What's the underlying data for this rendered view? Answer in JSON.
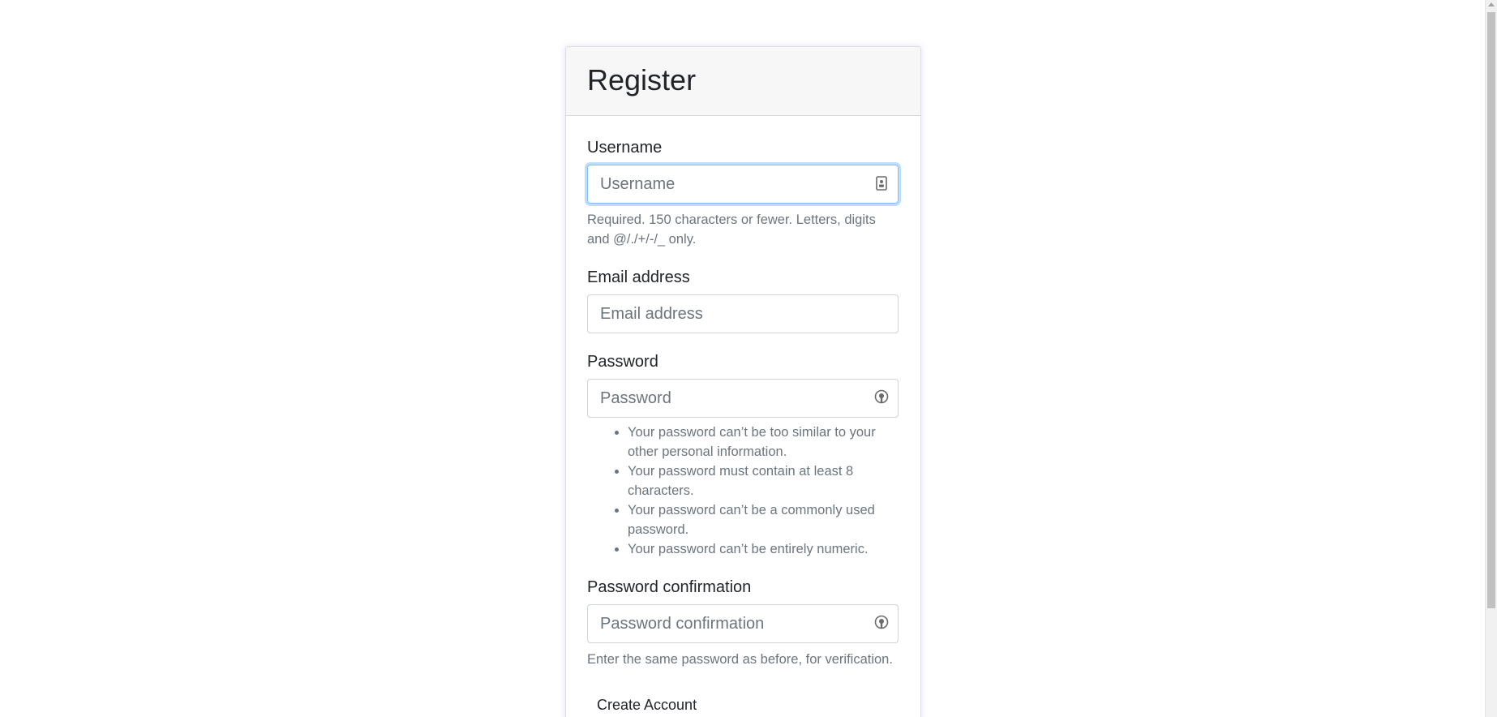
{
  "form": {
    "title": "Register",
    "username": {
      "label": "Username",
      "placeholder": "Username",
      "value": "",
      "help": "Required. 150 characters or fewer. Letters, digits and @/./+/-/_ only."
    },
    "email": {
      "label": "Email address",
      "placeholder": "Email address",
      "value": ""
    },
    "password": {
      "label": "Password",
      "placeholder": "Password",
      "value": "",
      "help_items": [
        "Your password can’t be too similar to your other personal information.",
        "Your password must contain at least 8 characters.",
        "Your password can’t be a commonly used password.",
        "Your password can’t be entirely numeric."
      ]
    },
    "password_confirmation": {
      "label": "Password confirmation",
      "placeholder": "Password confirmation",
      "value": "",
      "help": "Enter the same password as before, for verification."
    },
    "submit_label": "Create Account"
  },
  "icons": {
    "username_field": "contact-card-icon",
    "password_field": "password-key-icon",
    "password_confirmation_field": "password-key-icon"
  },
  "colors": {
    "focus_border": "#80bdff",
    "header_bg": "#f7f7f7",
    "muted_text": "#6c757d"
  }
}
